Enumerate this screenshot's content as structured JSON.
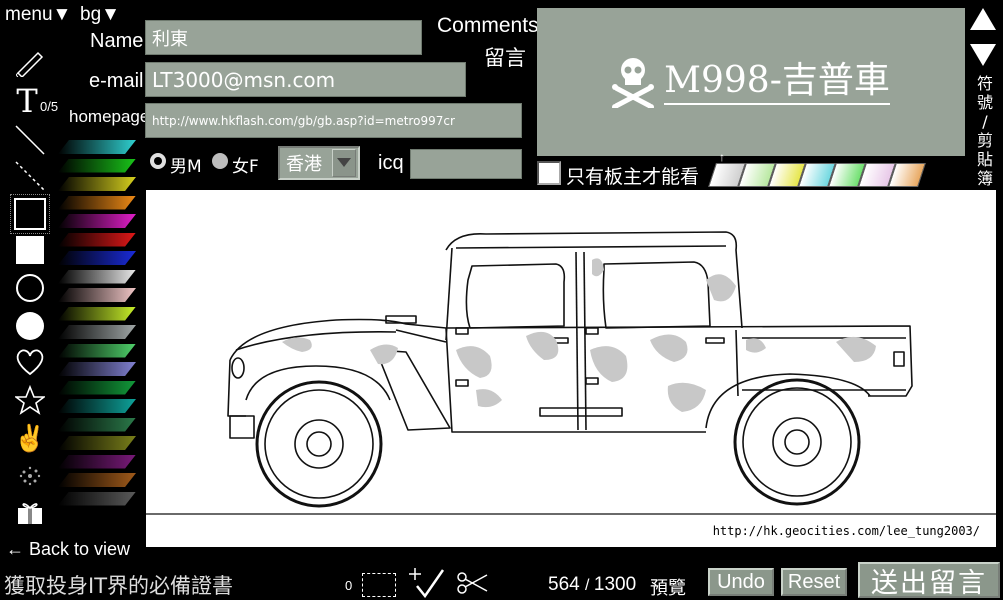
{
  "top": {
    "menu_label": "menu▼",
    "bg_label": "bg▼"
  },
  "form": {
    "name_label": "Name",
    "name_value": "利東",
    "email_label": "e-mail",
    "email_value": "LT3000@msn.com",
    "homepage_label": "homepage",
    "homepage_value": "http://www.hkflash.com/gb/gb.asp?id=metro997cr",
    "gender_male": "男M",
    "gender_female": "女F",
    "region": "香港",
    "icq_label": "icq",
    "icq_value": ""
  },
  "comments": {
    "title_en": "Comments",
    "title_zh": "留言",
    "message": "M998-吉普車",
    "private_label": "只有板主才能看"
  },
  "clipboard_label": [
    "符",
    "號",
    "/",
    "剪",
    "貼",
    "簿"
  ],
  "text_counter": "0/5",
  "canvas": {
    "url": "http://hk.geocities.com/lee_tung2003/"
  },
  "bottom": {
    "back_label": "Back to view",
    "ad_text": "獲取投身IT界的必備證書",
    "zero_counter": "0",
    "used": "564",
    "total": "1300",
    "preview_label": "預覽",
    "undo_label": "Undo",
    "reset_label": "Reset",
    "send_label": "送出留言"
  },
  "colors": {
    "panel": "#98a398",
    "background": "#000000"
  },
  "gradient_swatches": [
    "#2fd0d0",
    "#19c419",
    "#d6d01e",
    "#ee8a16",
    "#e01ec8",
    "#e01818",
    "#1a2bd8",
    "#e8e8e8",
    "#f1c6c6",
    "#c8f02a",
    "#9fa6a6",
    "#4fd06a",
    "#8080d0",
    "#129a3a",
    "#0ea39b",
    "#2b7a4a",
    "#7a7f1a",
    "#7a1a7a",
    "#a05a1a",
    "#5a5a5a"
  ],
  "palette_swatches": [
    "#cfcfcf",
    "#b8e8a0",
    "#e6e64a",
    "#6fd8e0",
    "#6ee06e",
    "#e8c8e8",
    "#e8a860"
  ]
}
